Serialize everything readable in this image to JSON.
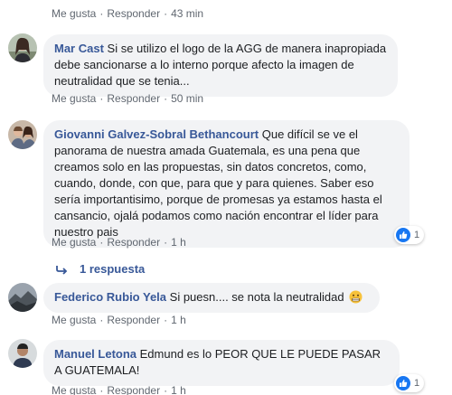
{
  "comments": [
    {
      "author": "",
      "text": "",
      "like_label": "Me gusta",
      "reply_label": "Responder",
      "time": "43 min"
    },
    {
      "author": "Mar Cast",
      "text": "Si se utilizo el logo de la AGG de manera inapropiada debe sancionarse a lo interno porque afecto la imagen de neutralidad que se tenia...",
      "like_label": "Me gusta",
      "reply_label": "Responder",
      "time": "50 min"
    },
    {
      "author": "Giovanni Galvez-Sobral Bethancourt",
      "text": "Que difícil se ve el panorama de nuestra amada Guatemala, es una pena que creamos solo en las propuestas, sin datos concretos, como, cuando, donde, con que, para que y para quienes. Saber eso sería importantisimo, porque de promesas ya estamos hasta el cansancio, ojalá podamos como nación encontrar el líder para nuestro pais",
      "like_label": "Me gusta",
      "reply_label": "Responder",
      "time": "1 h",
      "reactions": "1",
      "replies_label": "1 respuesta"
    },
    {
      "author": "Federico Rubio Yela",
      "text": "Si puesn.... se nota la neutralidad",
      "like_label": "Me gusta",
      "reply_label": "Responder",
      "time": "1 h"
    },
    {
      "author": "Manuel Letona",
      "text": "Edmund es lo PEOR QUE LE PUEDE PASAR A GUATEMALA!",
      "like_label": "Me gusta",
      "reply_label": "Responder",
      "time": "1 h",
      "reactions": "1"
    }
  ],
  "separator": "·",
  "colors": {
    "author": "#385898",
    "bubble": "#f2f3f5",
    "meta": "#606770",
    "like": "#1877f2"
  }
}
